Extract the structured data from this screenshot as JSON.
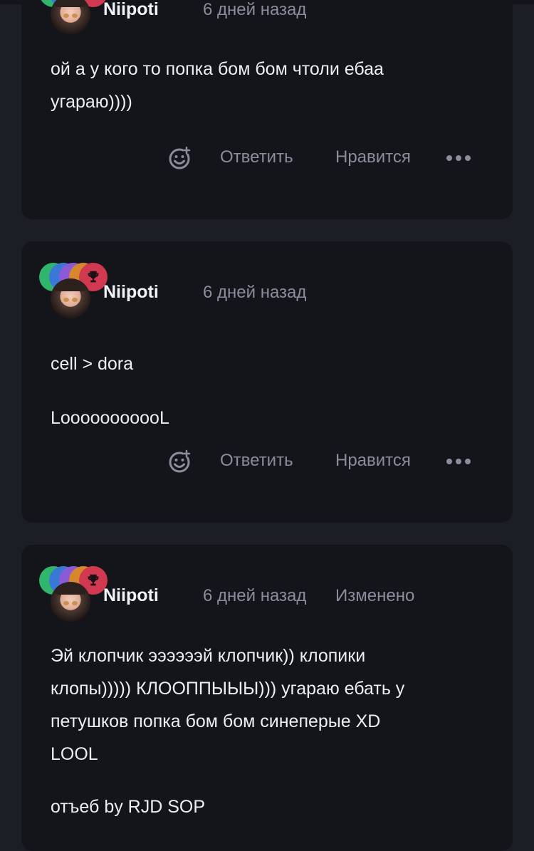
{
  "comments": [
    {
      "username": "Niipoti",
      "time": "6 дней назад",
      "edited": "",
      "lines": [
        "ой а у кого то попка бом бом чтоли ебаа",
        "угараю))))"
      ],
      "reply_label": "Ответить",
      "like_label": "Нравится"
    },
    {
      "username": "Niipoti",
      "time": "6 дней назад",
      "edited": "",
      "lines": [
        "cell > dora",
        "LooooooooooL"
      ],
      "reply_label": "Ответить",
      "like_label": "Нравится"
    },
    {
      "username": "Niipoti",
      "time": "6 дней назад",
      "edited": "Изменено",
      "lines": [
        "Эй клопчик ээээээй клопчик)) клопики",
        "клопы))))) КЛООППЫЫЫ))) угараю ебать у",
        "петушков попка бом бом синеперые XD",
        "LOOL",
        "отъеб by RJD SOP"
      ],
      "reply_label": "",
      "like_label": ""
    }
  ],
  "icons": {
    "badges": [
      "green-badge-icon",
      "blue-badge-icon",
      "purple-badge-icon",
      "orange-badge-icon",
      "trophy-icon"
    ],
    "reaction": "smiley-add-icon",
    "more": "more-dots-icon"
  },
  "colors": {
    "background": "#1c1e25",
    "card": "#14151b",
    "muted_text": "#8a8d9c",
    "primary_text": "#eceef3"
  }
}
